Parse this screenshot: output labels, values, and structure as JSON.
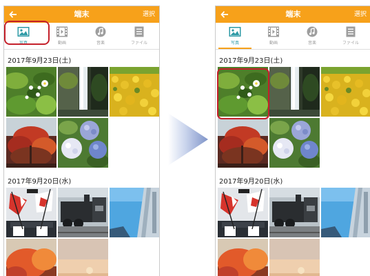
{
  "screens": [
    {
      "id": "left",
      "header": {
        "title": "端末",
        "select_label": "選択"
      },
      "tabs": [
        {
          "label": "写真",
          "icon": "photo-icon",
          "active": true
        },
        {
          "label": "動画",
          "icon": "film-icon",
          "active": false
        },
        {
          "label": "音楽",
          "icon": "music-icon",
          "active": false
        },
        {
          "label": "ファイル",
          "icon": "file-icon",
          "active": false
        }
      ],
      "sections": [
        {
          "date": "2017年9月23日(土)",
          "photos": [
            "white-flower-leaves",
            "waterfall",
            "yellow-flower-field",
            "autumn-tree",
            "hydrangea"
          ]
        },
        {
          "date": "2017年9月20日(水)",
          "photos": [
            "flags-event",
            "steam-locomotive",
            "skyscraper",
            "red-tree",
            "sunset-sky"
          ]
        }
      ],
      "highlight": "tab-photo"
    },
    {
      "id": "right",
      "header": {
        "title": "端末",
        "select_label": "選択"
      },
      "tabs": [
        {
          "label": "写真",
          "icon": "photo-icon",
          "active": true
        },
        {
          "label": "動画",
          "icon": "film-icon",
          "active": false
        },
        {
          "label": "音楽",
          "icon": "music-icon",
          "active": false
        },
        {
          "label": "ファイル",
          "icon": "file-icon",
          "active": false
        }
      ],
      "sections": [
        {
          "date": "2017年9月23日(土)",
          "photos": [
            "white-flower-leaves",
            "waterfall",
            "yellow-flower-field",
            "autumn-tree",
            "hydrangea"
          ]
        },
        {
          "date": "2017年9月20日(水)",
          "photos": [
            "flags-event",
            "steam-locomotive",
            "skyscraper",
            "red-tree",
            "sunset-sky"
          ]
        }
      ],
      "highlight": "first-photo"
    }
  ],
  "transition": {
    "icon": "arrow-right-icon"
  },
  "colors": {
    "header": "#f7a11a",
    "highlight": "#c4202a",
    "active_tab": "#2e9aa6",
    "inactive_tab": "#9e9e9e"
  }
}
